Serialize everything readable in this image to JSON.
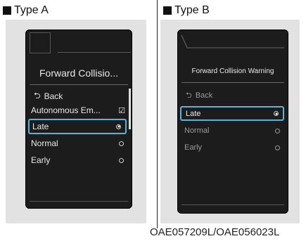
{
  "type_a": {
    "heading": "Type A",
    "title": "Forward Collisio...",
    "back": "Back",
    "items": [
      {
        "label": "Autonomous Em...",
        "control": "checkbox",
        "checked": true
      },
      {
        "label": "Late",
        "control": "radio",
        "selected": true
      },
      {
        "label": "Normal",
        "control": "radio",
        "selected": false
      },
      {
        "label": "Early",
        "control": "radio",
        "selected": false
      }
    ]
  },
  "type_b": {
    "heading": "Type B",
    "title": "Forward Collision Warning",
    "back": "Back",
    "items": [
      {
        "label": "Late",
        "control": "radio",
        "selected": true
      },
      {
        "label": "Normal",
        "control": "radio",
        "selected": false
      },
      {
        "label": "Early",
        "control": "radio",
        "selected": false
      }
    ]
  },
  "caption": "OAE057209L/OAE056023L",
  "colors": {
    "highlight": "#5bb4d7",
    "screen": "#1c1c1c"
  },
  "icons": {
    "back": "back-arrow-icon",
    "checkbox": "checkbox-checked-icon",
    "radio": "radio-icon"
  }
}
